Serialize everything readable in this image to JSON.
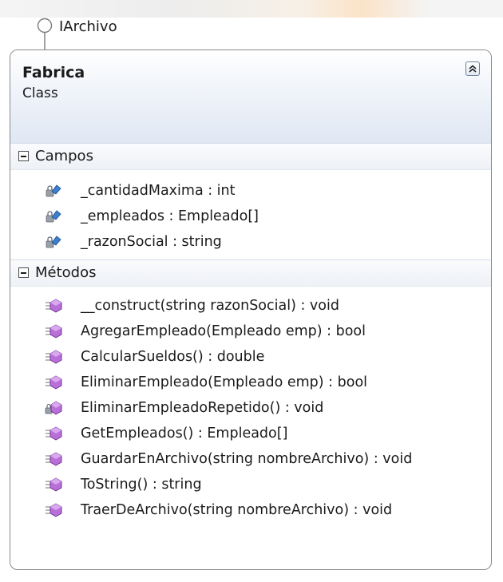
{
  "interface": {
    "name": "IArchivo"
  },
  "class": {
    "name": "Fabrica",
    "kind": "Class"
  },
  "sections": {
    "campos": {
      "label": "Campos",
      "items": [
        {
          "text": "_cantidadMaxima : int",
          "icon": "private-field-icon"
        },
        {
          "text": "_empleados : Empleado[]",
          "icon": "private-field-icon"
        },
        {
          "text": "_razonSocial : string",
          "icon": "private-field-icon"
        }
      ]
    },
    "metodos": {
      "label": "Métodos",
      "items": [
        {
          "text": "__construct(string razonSocial) : void",
          "icon": "public-method-icon"
        },
        {
          "text": "AgregarEmpleado(Empleado emp) : bool",
          "icon": "public-method-icon"
        },
        {
          "text": "CalcularSueldos() : double",
          "icon": "public-method-icon"
        },
        {
          "text": "EliminarEmpleado(Empleado emp) : bool",
          "icon": "public-method-icon"
        },
        {
          "text": "EliminarEmpleadoRepetido() : void",
          "icon": "private-method-icon"
        },
        {
          "text": "GetEmpleados() : Empleado[]",
          "icon": "public-method-icon"
        },
        {
          "text": "GuardarEnArchivo(string nombreArchivo) : void",
          "icon": "public-method-icon"
        },
        {
          "text": "ToString() : string",
          "icon": "public-method-icon"
        },
        {
          "text": "TraerDeArchivo(string nombreArchivo) : void",
          "icon": "public-method-icon"
        }
      ]
    }
  },
  "colors": {
    "field_icon": "#3a7fd0",
    "method_icon": "#a860c8",
    "box_border": "#8a8a8a",
    "header_gradient_end": "#dfe7f3"
  }
}
